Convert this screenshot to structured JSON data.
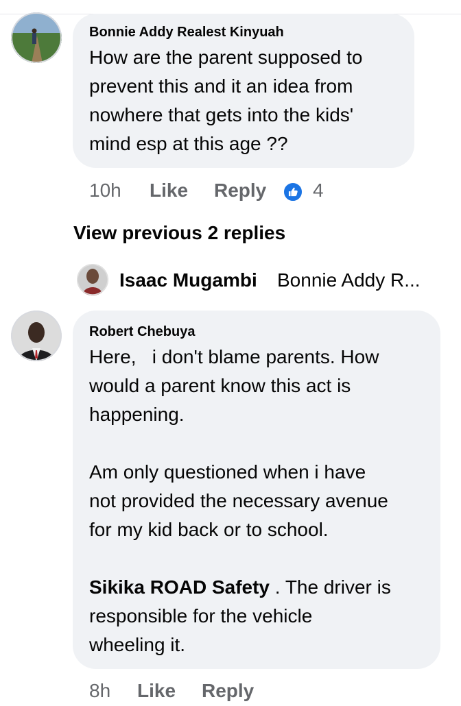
{
  "comments": [
    {
      "author": "Bonnie Addy Realest Kinyuah",
      "text": "How are the parent supposed to\nprevent this and it an idea from\nnowhere that gets into the kids'\nmind esp at this age ??",
      "time": "10h",
      "like_label": "Like",
      "reply_label": "Reply",
      "reaction_count": "4",
      "reaction_icon": "thumbs-up-icon"
    },
    {
      "author": "Robert Chebuya",
      "text_para1": "Here,   i don't blame parents. How\nwould a parent know this act is\nhappening.",
      "text_para2": "Am only questioned when i have\nnot provided the necessary avenue\nfor my kid back or to school.",
      "mention": "Sikika ROAD Safety",
      "text_para3_rest": " . The driver is\nresponsible for the vehicle\nwheeling it.",
      "time": "8h",
      "like_label": "Like",
      "reply_label": "Reply"
    }
  ],
  "view_previous": "View previous 2 replies",
  "reply_preview": {
    "author": "Isaac Mugambi",
    "snippet": "Bonnie Addy R..."
  },
  "colors": {
    "bubble": "#f0f2f5",
    "meta": "#65676b",
    "like_blue": "#1b74e4"
  }
}
